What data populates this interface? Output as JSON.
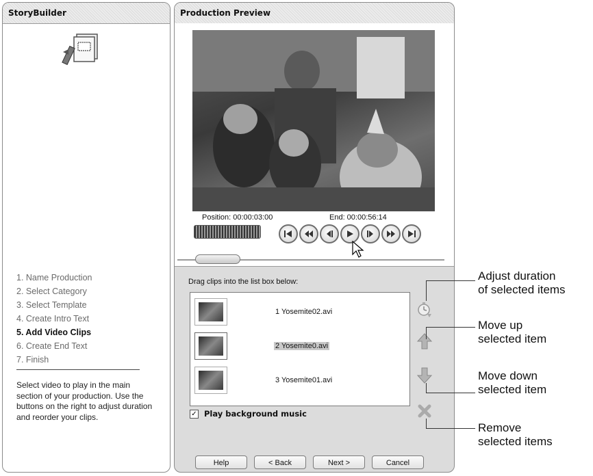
{
  "left": {
    "title": "StoryBuilder",
    "steps": [
      {
        "label": "1. Name Production",
        "active": false
      },
      {
        "label": "2. Select Category",
        "active": false
      },
      {
        "label": "3. Select Template",
        "active": false
      },
      {
        "label": "4. Create Intro Text",
        "active": false
      },
      {
        "label": "5. Add Video Clips",
        "active": true
      },
      {
        "label": "6. Create End Text",
        "active": false
      },
      {
        "label": "7. Finish",
        "active": false
      }
    ],
    "help": "Select video to play in the main section of your production. Use the buttons on the right to adjust duration and reorder your clips."
  },
  "preview": {
    "title": "Production Preview",
    "position": "Position:  00:00:03:00",
    "end": "End: 00:00:56:14"
  },
  "clips": {
    "instruction": "Drag clips into the list box below:",
    "items": [
      {
        "label": "1 Yosemite02.avi",
        "selected": false
      },
      {
        "label": "2 Yosemite0.avi",
        "selected": true
      },
      {
        "label": "3 Yosemite01.avi",
        "selected": false
      }
    ],
    "music_label": "Play background music",
    "music_checked": true
  },
  "buttons": {
    "help": "Help",
    "back": "< Back",
    "next": "Next >",
    "cancel": "Cancel"
  },
  "callouts": {
    "adjust_1": "Adjust duration",
    "adjust_2": "of selected items",
    "up_1": "Move up",
    "up_2": "selected item",
    "down_1": "Move down",
    "down_2": "selected item",
    "remove_1": "Remove",
    "remove_2": "selected items"
  },
  "colors": {
    "arrow": "#a8a8a8",
    "frame": "#8a8a8a"
  }
}
